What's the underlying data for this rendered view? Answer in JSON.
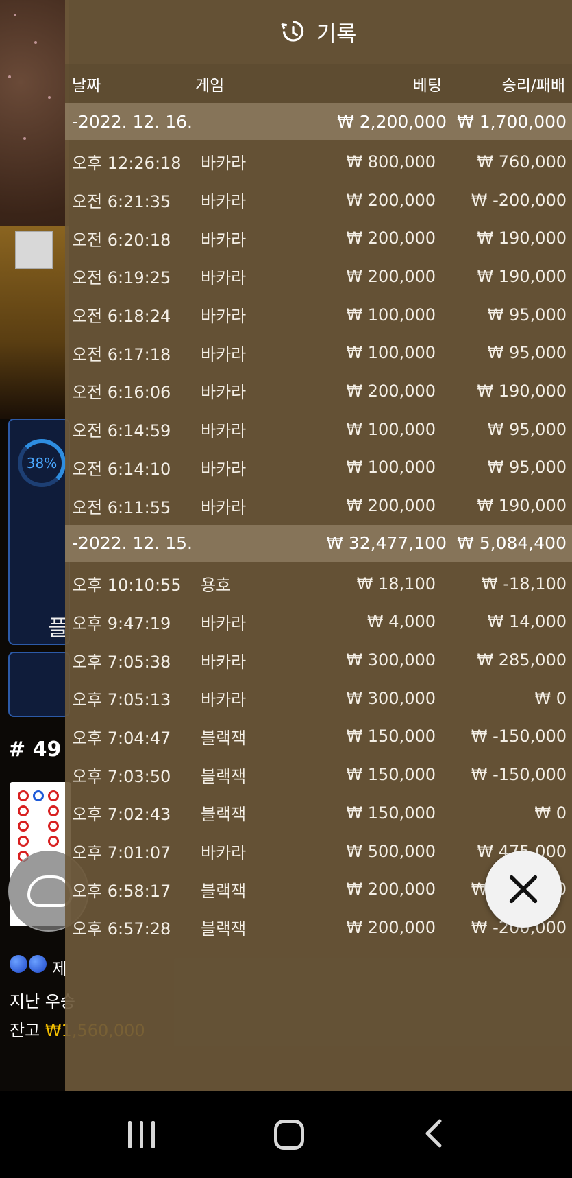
{
  "header": {
    "title": "기록",
    "icon": "history-icon"
  },
  "columns": {
    "date": "날짜",
    "game": "게임",
    "bet": "베팅",
    "result": "승리/패배"
  },
  "groups": [
    {
      "date": "-2022. 12. 16.",
      "bet": "₩ 2,200,000",
      "result": "₩ 1,700,000",
      "rows": [
        {
          "time": "오후 12:26:18",
          "game": "바카라",
          "bet": "₩ 800,000",
          "result": "₩ 760,000"
        },
        {
          "time": "오전 6:21:35",
          "game": "바카라",
          "bet": "₩ 200,000",
          "result": "₩ -200,000"
        },
        {
          "time": "오전 6:20:18",
          "game": "바카라",
          "bet": "₩ 200,000",
          "result": "₩ 190,000"
        },
        {
          "time": "오전 6:19:25",
          "game": "바카라",
          "bet": "₩ 200,000",
          "result": "₩ 190,000"
        },
        {
          "time": "오전 6:18:24",
          "game": "바카라",
          "bet": "₩ 100,000",
          "result": "₩ 95,000"
        },
        {
          "time": "오전 6:17:18",
          "game": "바카라",
          "bet": "₩ 100,000",
          "result": "₩ 95,000"
        },
        {
          "time": "오전 6:16:06",
          "game": "바카라",
          "bet": "₩ 200,000",
          "result": "₩ 190,000"
        },
        {
          "time": "오전 6:14:59",
          "game": "바카라",
          "bet": "₩ 100,000",
          "result": "₩ 95,000"
        },
        {
          "time": "오전 6:14:10",
          "game": "바카라",
          "bet": "₩ 100,000",
          "result": "₩ 95,000"
        },
        {
          "time": "오전 6:11:55",
          "game": "바카라",
          "bet": "₩ 200,000",
          "result": "₩ 190,000"
        }
      ]
    },
    {
      "date": "-2022. 12. 15.",
      "bet": "₩ 32,477,100",
      "result": "₩ 5,084,400",
      "rows": [
        {
          "time": "오후 10:10:55",
          "game": "용호",
          "bet": "₩ 18,100",
          "result": "₩ -18,100"
        },
        {
          "time": "오후 9:47:19",
          "game": "바카라",
          "bet": "₩ 4,000",
          "result": "₩ 14,000"
        },
        {
          "time": "오후 7:05:38",
          "game": "바카라",
          "bet": "₩ 300,000",
          "result": "₩ 285,000"
        },
        {
          "time": "오후 7:05:13",
          "game": "바카라",
          "bet": "₩ 300,000",
          "result": "₩ 0"
        },
        {
          "time": "오후 7:04:47",
          "game": "블랙잭",
          "bet": "₩ 150,000",
          "result": "₩ -150,000"
        },
        {
          "time": "오후 7:03:50",
          "game": "블랙잭",
          "bet": "₩ 150,000",
          "result": "₩ -150,000"
        },
        {
          "time": "오후 7:02:43",
          "game": "블랙잭",
          "bet": "₩ 150,000",
          "result": "₩ 0"
        },
        {
          "time": "오후 7:01:07",
          "game": "바카라",
          "bet": "₩ 500,000",
          "result": "₩ 475,000"
        },
        {
          "time": "오후 6:58:17",
          "game": "블랙잭",
          "bet": "₩ 200,000",
          "result": "₩ -200,000"
        },
        {
          "time": "오후 6:57:28",
          "game": "블랙잭",
          "bet": "₩ 200,000",
          "result": "₩ -200,000"
        }
      ]
    }
  ],
  "background": {
    "win_rate": "38%",
    "stat_label": "플",
    "round": "# 49",
    "balls_label": "제",
    "last_win_label": "지난 우승",
    "balance_label": "잔고",
    "balance_value": "₩1,560,000"
  },
  "close_label": "close",
  "colors": {
    "panel": "#6c583a",
    "group_bar": "#918066",
    "accent_blue": "#2e8de0",
    "gold": "#f5c000"
  }
}
